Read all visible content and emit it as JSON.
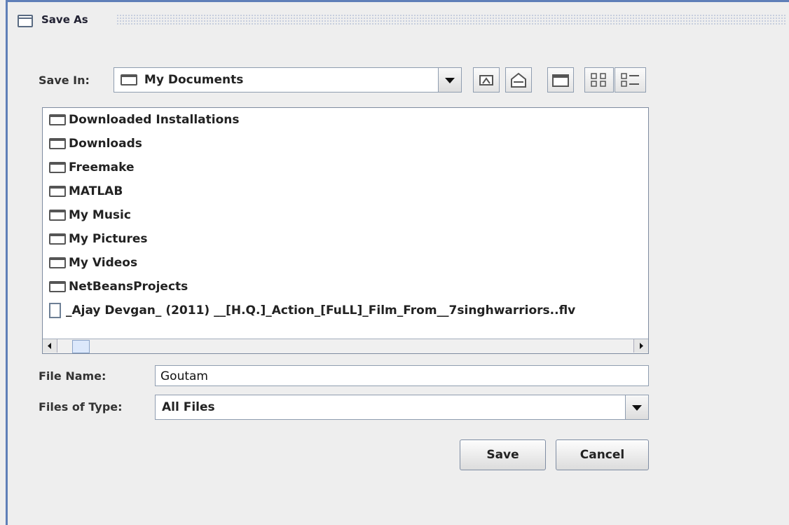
{
  "window": {
    "title": "Save As"
  },
  "save_in": {
    "label": "Save In:",
    "value": "My Documents",
    "toolbar_icons": [
      "up-one-level-icon",
      "home-icon",
      "new-folder-icon",
      "list-view-icon",
      "details-view-icon"
    ]
  },
  "files": [
    {
      "name": "Downloaded Installations",
      "kind": "folder"
    },
    {
      "name": "Downloads",
      "kind": "folder"
    },
    {
      "name": "Freemake",
      "kind": "folder"
    },
    {
      "name": "MATLAB",
      "kind": "folder"
    },
    {
      "name": "My Music",
      "kind": "folder"
    },
    {
      "name": "My Pictures",
      "kind": "folder"
    },
    {
      "name": "My Videos",
      "kind": "folder"
    },
    {
      "name": "NetBeansProjects",
      "kind": "folder"
    },
    {
      "name": "_Ajay Devgan_ (2011) __[H.Q.]_Action_[FuLL]_Film_From__7singhwarriors..flv",
      "kind": "file"
    }
  ],
  "file_name": {
    "label": "File Name:",
    "value": "Goutam"
  },
  "file_type": {
    "label": "Files of Type:",
    "value": "All Files"
  },
  "buttons": {
    "save": "Save",
    "cancel": "Cancel"
  },
  "colors": {
    "window_border": "#5f7fb8",
    "panel": "#eeeeee",
    "list_bg": "#ffffff"
  }
}
